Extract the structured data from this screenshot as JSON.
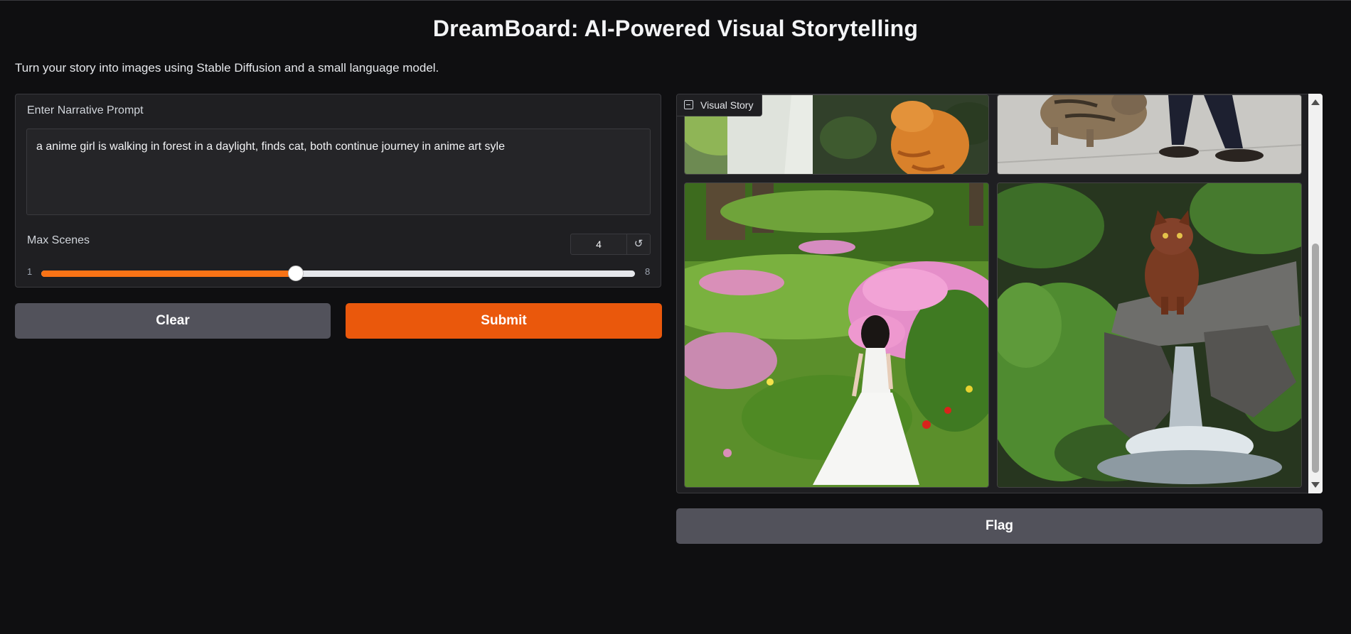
{
  "header": {
    "title": "DreamBoard: AI-Powered Visual Storytelling",
    "description": "Turn your story into images using Stable Diffusion and a small language model."
  },
  "prompt": {
    "label": "Enter Narrative Prompt",
    "value": "a anime girl is walking in forest in a daylight, finds cat, both continue journey in anime art syle"
  },
  "max_scenes": {
    "label": "Max Scenes",
    "value": "4",
    "min": "1",
    "max": "8",
    "fraction": 0.4286,
    "reset_icon": "reset-icon",
    "reset_glyph": "↺"
  },
  "buttons": {
    "clear": "Clear",
    "submit": "Submit",
    "flag": "Flag"
  },
  "gallery": {
    "label": "Visual Story",
    "label_icon": "image-icon",
    "images": [
      {
        "desc": "anime girl and orange cat in forest (top, cropped)"
      },
      {
        "desc": "tabby cat walking next to person (top, cropped)"
      },
      {
        "desc": "girl in white dress walking in flower garden"
      },
      {
        "desc": "brown cat sitting on rock by waterfall"
      }
    ]
  },
  "colors": {
    "accent": "#ea580c",
    "background": "#0f0f11",
    "panel": "#1f1f22",
    "secondary_button": "#52525b"
  }
}
